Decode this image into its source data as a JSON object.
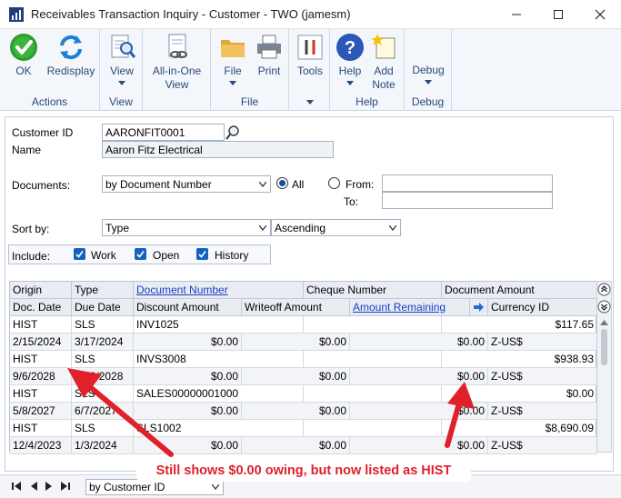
{
  "window": {
    "title": "Receivables Transaction Inquiry - Customer  -  TWO (jamesm)"
  },
  "ribbon": {
    "groups": [
      {
        "label": "Actions",
        "buttons": [
          {
            "label": "OK"
          },
          {
            "label": "Redisplay"
          }
        ]
      },
      {
        "label": "View",
        "buttons": [
          {
            "label": "View"
          }
        ]
      },
      {
        "label": "",
        "buttons": [
          {
            "label1": "All-in-One",
            "label2": "View"
          }
        ]
      },
      {
        "label": "File",
        "buttons": [
          {
            "label": "File"
          },
          {
            "label": "Print"
          }
        ]
      },
      {
        "label": "",
        "buttons": [
          {
            "label": "Tools"
          }
        ]
      },
      {
        "label": "Help",
        "buttons": [
          {
            "label": "Help"
          },
          {
            "label1": "Add",
            "label2": "Note"
          }
        ]
      },
      {
        "label": "Debug",
        "buttons": [
          {
            "label": "Debug"
          }
        ]
      }
    ]
  },
  "form": {
    "customer_id_label": "Customer ID",
    "customer_id_value": "AARONFIT0001",
    "name_label": "Name",
    "name_value": "Aaron Fitz Electrical",
    "documents_label": "Documents:",
    "documents_value": "by Document Number",
    "all_label": "All",
    "from_label": "From:",
    "to_label": "To:",
    "sortby_label": "Sort by:",
    "sortby_value": "Type",
    "sortorder_value": "Ascending",
    "include_label": "Include:",
    "include_work": "Work",
    "include_open": "Open",
    "include_history": "History"
  },
  "grid": {
    "header1": [
      "Origin",
      "Type",
      "Document Number",
      "Cheque Number",
      "Document Amount"
    ],
    "header2": [
      "Doc. Date",
      "Due Date",
      "Discount Amount",
      "Writeoff Amount",
      "Amount Remaining",
      "Currency ID"
    ],
    "rows": [
      {
        "origin": "HIST",
        "type": "SLS",
        "docnum": "INV1025",
        "cheque": "",
        "amount": "$117.65",
        "docdate": "2/15/2024",
        "duedate": "3/17/2024",
        "discount": "$0.00",
        "writeoff": "$0.00",
        "remaining": "$0.00",
        "currency": "Z-US$"
      },
      {
        "origin": "HIST",
        "type": "SLS",
        "docnum": "INVS3008",
        "cheque": "",
        "amount": "$938.93",
        "docdate": "9/6/2028",
        "duedate": "10/6/2028",
        "discount": "$0.00",
        "writeoff": "$0.00",
        "remaining": "$0.00",
        "currency": "Z-US$"
      },
      {
        "origin": "HIST",
        "type": "SLS",
        "docnum": "SALES00000001000",
        "cheque": "",
        "amount": "$0.00",
        "docdate": "5/8/2027",
        "duedate": "6/7/2027",
        "discount": "$0.00",
        "writeoff": "$0.00",
        "remaining": "$0.00",
        "currency": "Z-US$"
      },
      {
        "origin": "HIST",
        "type": "SLS",
        "docnum": "SLS1002",
        "cheque": "",
        "amount": "$8,690.09",
        "docdate": "12/4/2023",
        "duedate": "1/3/2024",
        "discount": "$0.00",
        "writeoff": "$0.00",
        "remaining": "$0.00",
        "currency": "Z-US$"
      }
    ]
  },
  "footer": {
    "sort_value": "by Customer ID"
  },
  "annotation": {
    "text": "Still shows $0.00 owing, but now listed as HIST"
  },
  "colors": {
    "accent": "#2b4a78",
    "annotation": "#e0202a",
    "link": "#1b3fc4"
  }
}
